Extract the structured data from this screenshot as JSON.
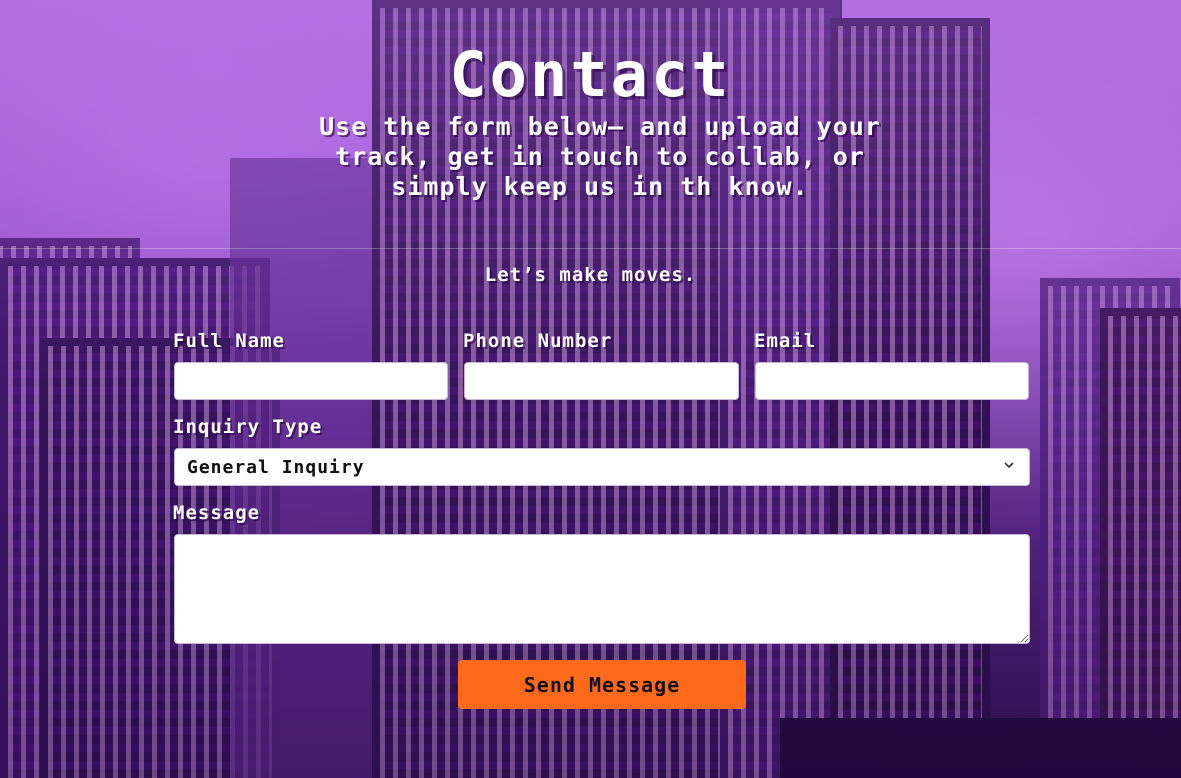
{
  "header": {
    "title": "Contact",
    "subtitle": "Use the form below— and upload your track, get in touch to collab, or simply keep us in th know.",
    "tagline": "Let’s make moves."
  },
  "form": {
    "full_name_label": "Full Name",
    "full_name_value": "",
    "phone_label": "Phone Number",
    "phone_value": "",
    "email_label": "Email",
    "email_value": "",
    "inquiry_label": "Inquiry Type",
    "inquiry_selected": "General Inquiry",
    "message_label": "Message",
    "message_value": "",
    "submit_label": "Send Message"
  },
  "colors": {
    "accent": "#ff6a1a",
    "background": "#6a2fa0",
    "text": "#ffffff"
  },
  "icons": {
    "select_chevron": "chevron-down-icon"
  }
}
